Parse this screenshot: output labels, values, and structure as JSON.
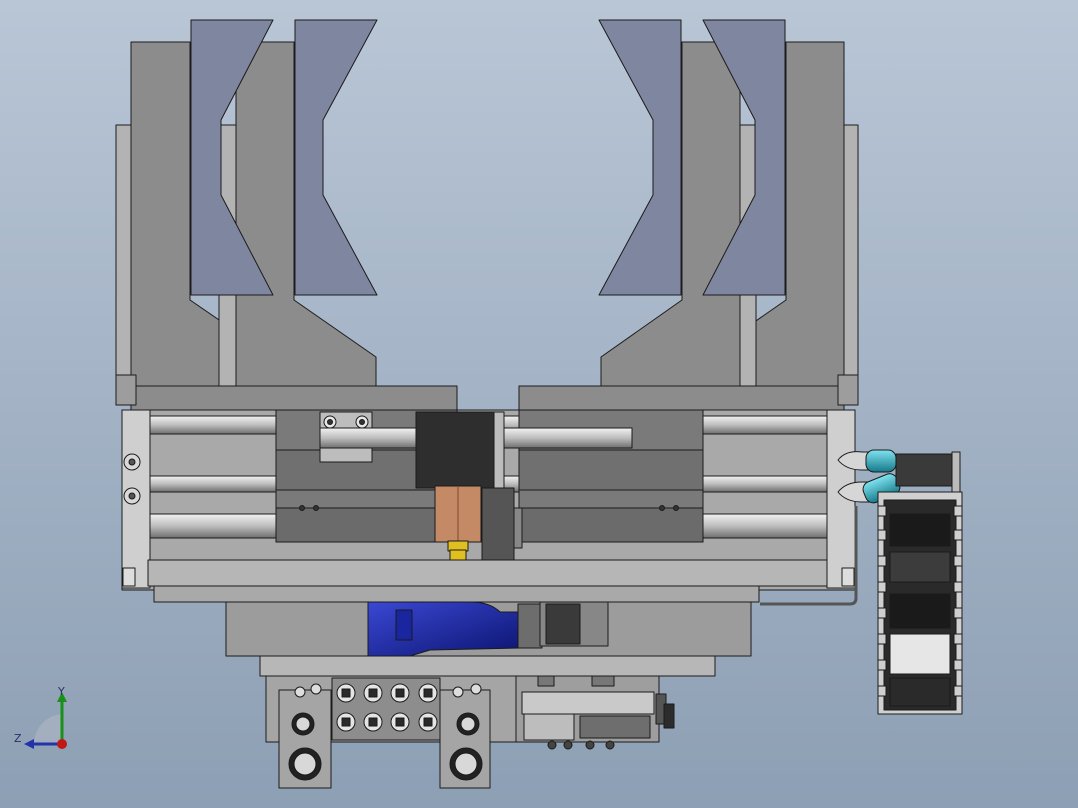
{
  "viewport": {
    "background_top": "#b9c6d6",
    "background_bottom": "#8d9fb4"
  },
  "colors": {
    "gray_dark": "#6f6f70",
    "gray_mid": "#8c8c8d",
    "gray_light": "#b3b3b4",
    "gray_pale": "#cfcfd0",
    "jaw_slate": "#7f86a0",
    "motor_blue": "#1d2aa8",
    "fitting_brass": "#e0c020",
    "fitting_copper": "#c48a66",
    "fitting_cyan": "#2fb2c8",
    "outline": "#1b1b1b",
    "cable_chain": "#2a2a2a"
  },
  "triad": {
    "y_label": "Y",
    "z_label": "Z",
    "icon": "coordinate-triad-icon"
  }
}
